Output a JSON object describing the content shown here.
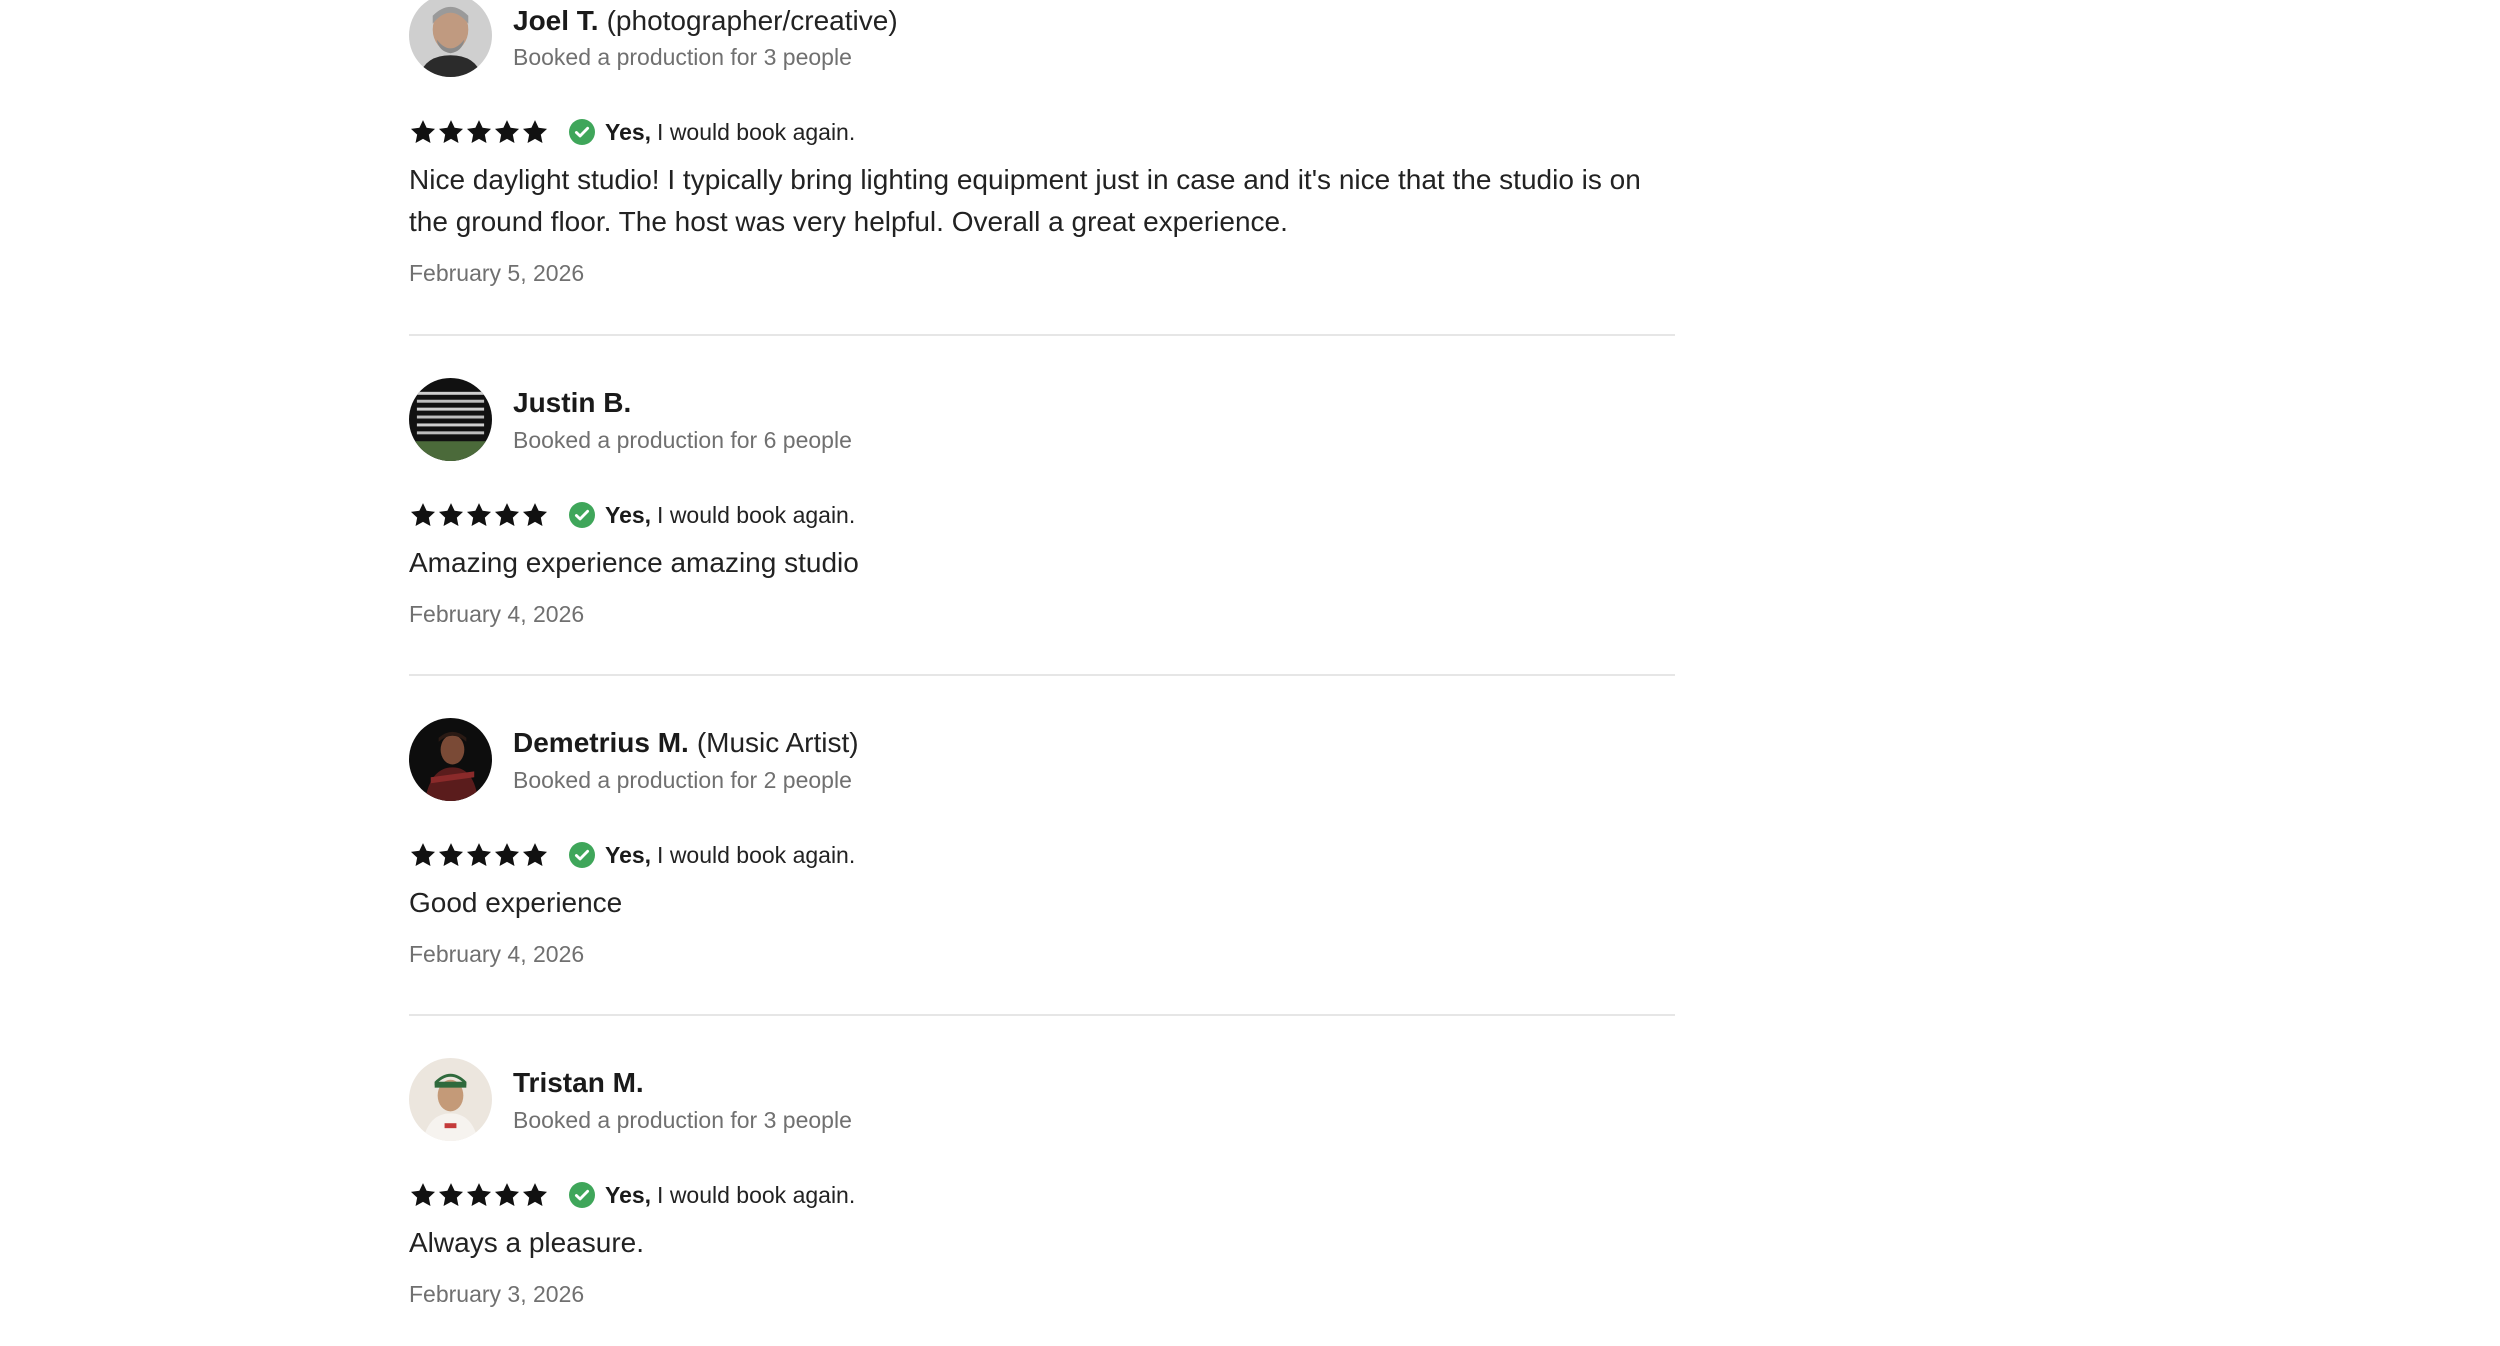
{
  "colors": {
    "check_green": "#3fa65a",
    "star": "#111111",
    "muted_text": "#707070",
    "divider": "#e6e6e6"
  },
  "reviews": [
    {
      "name": "Joel T.",
      "role": "(photographer/creative)",
      "booked": "Booked a production for 3 people",
      "rating": 5,
      "yes": "Yes,",
      "again": "I would book again.",
      "text": "Nice daylight studio! I typically bring lighting equipment just in case and it's nice that the studio is on the ground floor. The host was very helpful. Overall a great experience.",
      "date": "February 5, 2026"
    },
    {
      "name": "Justin B.",
      "role": "",
      "booked": "Booked a production for 6 people",
      "rating": 5,
      "yes": "Yes,",
      "again": "I would book again.",
      "text": "Amazing experience amazing studio",
      "date": "February 4, 2026"
    },
    {
      "name": "Demetrius M.",
      "role": "(Music Artist)",
      "booked": "Booked a production for 2 people",
      "rating": 5,
      "yes": "Yes,",
      "again": "I would book again.",
      "text": "Good experience",
      "date": "February 4, 2026"
    },
    {
      "name": "Tristan M.",
      "role": "",
      "booked": "Booked a production for 3 people",
      "rating": 5,
      "yes": "Yes,",
      "again": "I would book again.",
      "text": "Always a pleasure.",
      "date": "February 3, 2026"
    }
  ]
}
